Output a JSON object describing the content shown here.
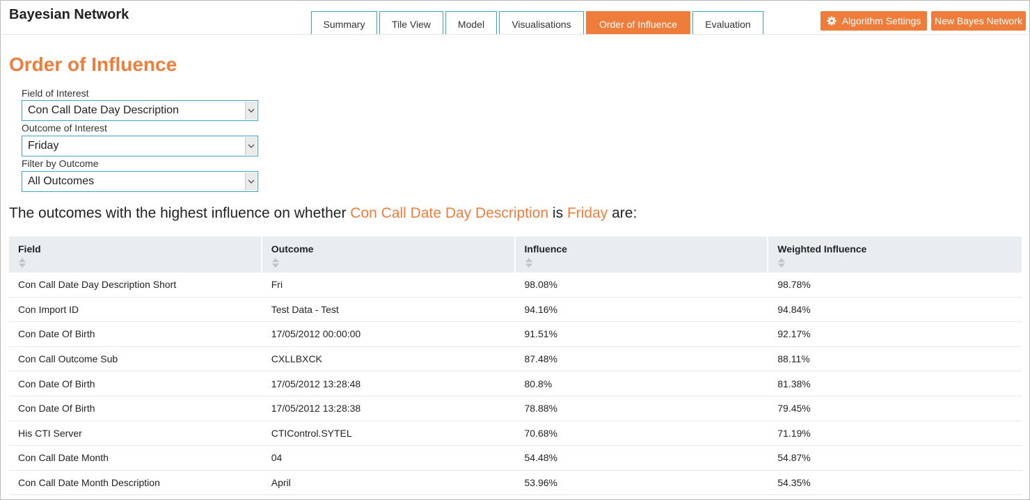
{
  "app": {
    "title": "Bayesian Network"
  },
  "tabs": [
    {
      "label": "Summary",
      "active": false
    },
    {
      "label": "Tile View",
      "active": false
    },
    {
      "label": "Model",
      "active": false
    },
    {
      "label": "Visualisations",
      "active": false
    },
    {
      "label": "Order of Influence",
      "active": true
    },
    {
      "label": "Evaluation",
      "active": false
    }
  ],
  "toolbar": {
    "algorithm_settings_label": "Algorithm Settings",
    "new_bayes_network_label": "New Bayes Network"
  },
  "page": {
    "title": "Order of Influence"
  },
  "form": {
    "field_of_interest": {
      "label": "Field of Interest",
      "value": "Con Call Date Day Description"
    },
    "outcome_of_interest": {
      "label": "Outcome of Interest",
      "value": "Friday"
    },
    "filter_by_outcome": {
      "label": "Filter by Outcome",
      "value": "All Outcomes"
    }
  },
  "headline": {
    "prefix": "The outcomes with the highest influence on whether ",
    "field": "Con Call Date Day Description",
    "middle": " is ",
    "outcome": "Friday",
    "suffix": " are:"
  },
  "table": {
    "columns": [
      "Field",
      "Outcome",
      "Influence",
      "Weighted Influence"
    ],
    "rows": [
      [
        "Con Call Date Day Description Short",
        "Fri",
        "98.08%",
        "98.78%"
      ],
      [
        "Con Import ID",
        "Test Data - Test",
        "94.16%",
        "94.84%"
      ],
      [
        "Con Date Of Birth",
        "17/05/2012 00:00:00",
        "91.51%",
        "92.17%"
      ],
      [
        "Con Call Outcome Sub",
        "CXLLBXCK",
        "87.48%",
        "88.11%"
      ],
      [
        "Con Date Of Birth",
        "17/05/2012 13:28:48",
        "80.8%",
        "81.38%"
      ],
      [
        "Con Date Of Birth",
        "17/05/2012 13:28:38",
        "78.88%",
        "79.45%"
      ],
      [
        "His CTI Server",
        "CTIControl.SYTEL",
        "70.68%",
        "71.19%"
      ],
      [
        "Con Call Date Month",
        "04",
        "54.48%",
        "54.87%"
      ],
      [
        "Con Call Date Month Description",
        "April",
        "53.96%",
        "54.35%"
      ]
    ]
  },
  "colors": {
    "accent": "#ee7d3b",
    "border": "#3aa7c2",
    "table_header_bg": "#e9edf0"
  },
  "icons": {
    "settings": "gear-icon",
    "sort": "sort-icon",
    "dropdown": "chevron-down-icon"
  }
}
